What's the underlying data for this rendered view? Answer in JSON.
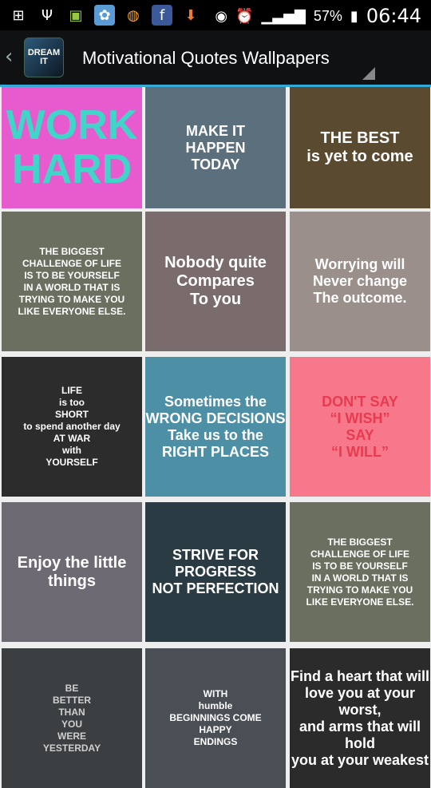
{
  "status_bar": {
    "battery": "57%",
    "time": "06:44",
    "icons": [
      "add-icon",
      "usb-icon",
      "android-icon",
      "share-icon",
      "planet-icon",
      "facebook-icon",
      "download-icon",
      "eye-icon",
      "alarm-icon",
      "signal-icon",
      "battery-icon"
    ]
  },
  "action_bar": {
    "title": "Motivational Quotes Wallpapers",
    "app_icon_text": "DREAM IT"
  },
  "tiles": [
    {
      "lines": [
        "WORK",
        "HARD"
      ],
      "bg": "#e75bcf",
      "fg": "#3fd6c9"
    },
    {
      "lines": [
        "MAKE IT",
        "HAPPEN",
        "TODAY"
      ],
      "bg": "#5c6f7c",
      "fg": "#ffffff"
    },
    {
      "lines": [
        "THE BEST",
        "is yet to come"
      ],
      "bg": "#5a4a30",
      "fg": "#ffffff"
    },
    {
      "lines": [
        "THE BIGGEST",
        "CHALLENGE OF LIFE",
        "IS TO BE YOURSELF",
        "IN A WORLD THAT IS",
        "TRYING TO MAKE YOU",
        "LIKE EVERYONE ELSE."
      ],
      "bg": "#6a6f60",
      "fg": "#ffffff"
    },
    {
      "lines": [
        "Nobody quite Compares",
        "To you"
      ],
      "bg": "#7a6c6c",
      "fg": "#ffffff"
    },
    {
      "lines": [
        "Worrying will",
        "Never change",
        "The outcome."
      ],
      "bg": "#9a8f8b",
      "fg": "#ffffff"
    },
    {
      "lines": [
        "LIFE",
        "is too",
        "SHORT",
        "to spend another day",
        "AT WAR",
        "with",
        "YOURSELF"
      ],
      "bg": "#2c2c2c",
      "fg": "#ffffff"
    },
    {
      "lines": [
        "Sometimes the",
        "WRONG DECISIONS",
        "Take us to the",
        "RIGHT PLACES"
      ],
      "bg": "#4d8fa5",
      "fg": "#ffffff"
    },
    {
      "lines": [
        "DON'T SAY",
        "“I WISH”",
        "SAY",
        "“I WILL”"
      ],
      "bg": "#f7788a",
      "fg": "#e83b52"
    },
    {
      "lines": [
        "Enjoy the little things"
      ],
      "bg": "#6e6a74",
      "fg": "#ffffff"
    },
    {
      "lines": [
        "STRIVE FOR",
        "PROGRESS",
        "NOT PERFECTION"
      ],
      "bg": "#2a3b44",
      "fg": "#ffffff"
    },
    {
      "lines": [
        "THE BIGGEST",
        "CHALLENGE OF LIFE",
        "IS TO BE YOURSELF",
        "IN A WORLD THAT IS",
        "TRYING TO MAKE YOU",
        "LIKE EVERYONE ELSE."
      ],
      "bg": "#6a6f60",
      "fg": "#ffffff"
    },
    {
      "lines": [
        "BE",
        "BETTER",
        "THAN",
        "YOU",
        "WERE",
        "YESTERDAY"
      ],
      "bg": "#3c3f42",
      "fg": "#cfcfcf"
    },
    {
      "lines": [
        "WITH",
        "humble",
        "BEGINNINGS COME",
        "HAPPY",
        "ENDINGS"
      ],
      "bg": "#4a4f55",
      "fg": "#ffffff"
    },
    {
      "lines": [
        "Find a heart that will",
        "love you at your worst,",
        "and arms that will hold",
        "you at your weakest"
      ],
      "bg": "#2b2b2b",
      "fg": "#ffffff"
    }
  ]
}
